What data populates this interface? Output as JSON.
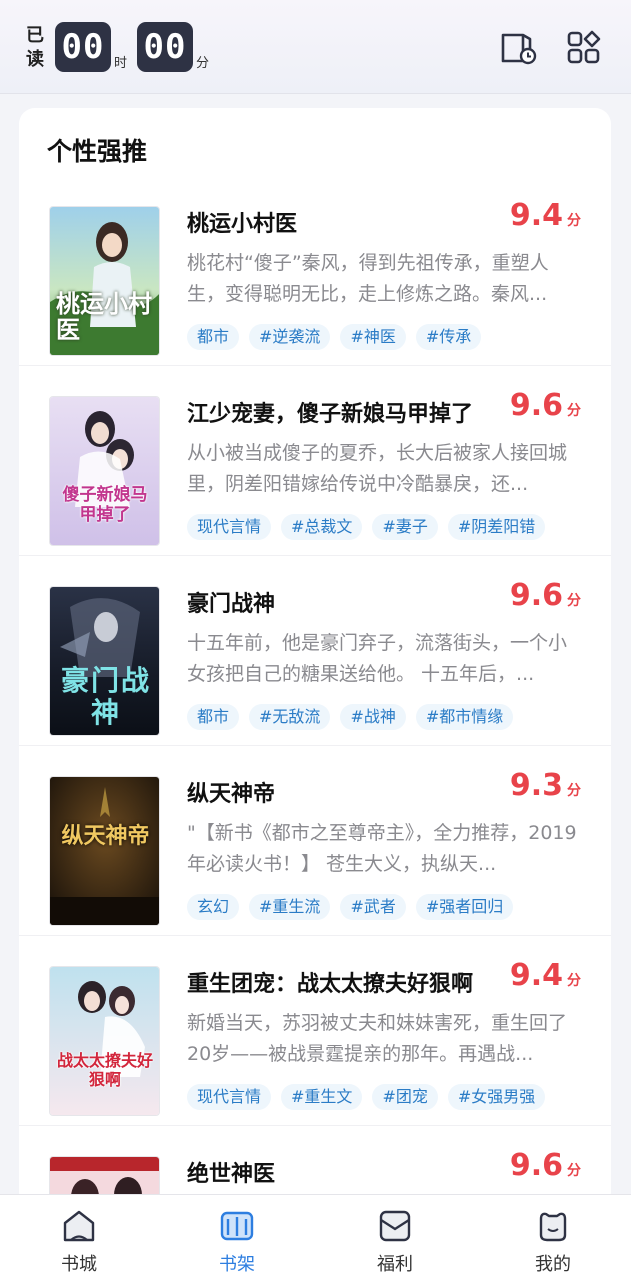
{
  "header": {
    "read_label": "已读",
    "hours": "00",
    "hours_unit": "时",
    "minutes": "00",
    "minutes_unit": "分"
  },
  "section": {
    "title": "个性强推"
  },
  "books": [
    {
      "title": "桃运小村医",
      "score": "9.4",
      "score_unit": "分",
      "desc": "桃花村“傻子”秦风，得到先祖传承，重塑人生，变得聪明无比，走上修炼之路。秦风...",
      "tags": [
        "都市",
        "#逆袭流",
        "#神医",
        "#传承"
      ],
      "cover_text": "桃运小村医"
    },
    {
      "title": "江少宠妻，傻子新娘马甲掉了",
      "score": "9.6",
      "score_unit": "分",
      "desc": "从小被当成傻子的夏乔，长大后被家人接回城里，阴差阳错嫁给传说中冷酷暴戾，还...",
      "tags": [
        "现代言情",
        "#总裁文",
        "#妻子",
        "#阴差阳错"
      ],
      "cover_text": "傻子新娘马甲掉了"
    },
    {
      "title": "豪门战神",
      "score": "9.6",
      "score_unit": "分",
      "desc": "十五年前，他是豪门弃子，流落街头，一个小女孩把自己的糖果送给他。 十五年后，...",
      "tags": [
        "都市",
        "#无敌流",
        "#战神",
        "#都市情缘"
      ],
      "cover_text": "豪门战神"
    },
    {
      "title": "纵天神帝",
      "score": "9.3",
      "score_unit": "分",
      "desc": "\"【新书《都市之至尊帝主》，全力推荐，2019年必读火书！】 苍生大义，执纵天...",
      "tags": [
        "玄幻",
        "#重生流",
        "#武者",
        "#强者回归"
      ],
      "cover_text": "纵天神帝"
    },
    {
      "title": "重生团宠：战太太撩夫好狠啊",
      "score": "9.4",
      "score_unit": "分",
      "desc": "新婚当天，苏羽被丈夫和妹妹害死，重生回了20岁——被战景霆提亲的那年。再遇战...",
      "tags": [
        "现代言情",
        "#重生文",
        "#团宠",
        "#女强男强"
      ],
      "cover_text": "战太太撩夫好狠啊"
    },
    {
      "title": "绝世神医",
      "score": "9.6",
      "score_unit": "分",
      "desc": "",
      "tags": [],
      "cover_text": ""
    }
  ],
  "tabbar": {
    "items": [
      {
        "label": "书城",
        "icon": "bookstore-icon"
      },
      {
        "label": "书架",
        "icon": "bookshelf-icon"
      },
      {
        "label": "福利",
        "icon": "welfare-icon"
      },
      {
        "label": "我的",
        "icon": "profile-icon"
      }
    ],
    "active_index": 1
  },
  "colors": {
    "accent": "#2d7ee0",
    "score": "#e8434a",
    "tag_text": "#2b7cc6",
    "tag_bg": "#eef6fc"
  }
}
